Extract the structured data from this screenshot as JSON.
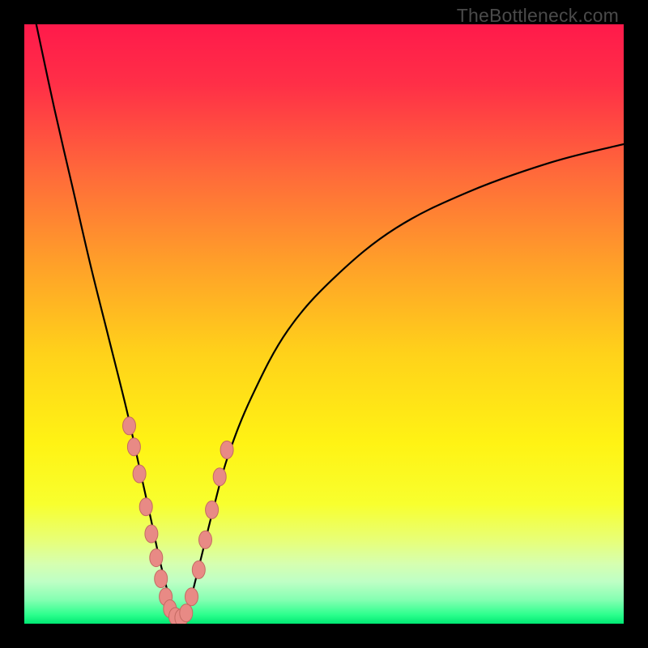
{
  "watermark": "TheBottleneck.com",
  "chart_data": {
    "type": "line",
    "title": "",
    "xlabel": "",
    "ylabel": "",
    "xlim": [
      0,
      100
    ],
    "ylim": [
      0,
      100
    ],
    "notch_x_percent": 26,
    "background_gradient": {
      "stops": [
        {
          "position": 0.0,
          "color": "#ff1a4b"
        },
        {
          "position": 0.1,
          "color": "#ff2f47"
        },
        {
          "position": 0.25,
          "color": "#ff6a3a"
        },
        {
          "position": 0.4,
          "color": "#ffa029"
        },
        {
          "position": 0.55,
          "color": "#ffd21a"
        },
        {
          "position": 0.7,
          "color": "#fff314"
        },
        {
          "position": 0.8,
          "color": "#f8ff2e"
        },
        {
          "position": 0.86,
          "color": "#e8ff76"
        },
        {
          "position": 0.9,
          "color": "#d6ffb0"
        },
        {
          "position": 0.93,
          "color": "#beffc5"
        },
        {
          "position": 0.96,
          "color": "#85ffb2"
        },
        {
          "position": 0.985,
          "color": "#2dff8d"
        },
        {
          "position": 1.0,
          "color": "#00e873"
        }
      ]
    },
    "series": [
      {
        "name": "bottleneck-curve",
        "x": [
          2.0,
          5.0,
          8.0,
          11.0,
          14.0,
          17.0,
          19.0,
          21.0,
          22.5,
          24.0,
          25.0,
          26.0,
          27.0,
          28.0,
          29.5,
          31.5,
          34.0,
          38.0,
          44.0,
          52.0,
          62.0,
          74.0,
          88.0,
          100.0
        ],
        "y": [
          100.0,
          86.0,
          73.0,
          60.0,
          48.0,
          36.0,
          27.0,
          18.0,
          11.0,
          5.0,
          1.5,
          0.5,
          1.5,
          5.0,
          11.0,
          19.0,
          28.0,
          38.0,
          49.0,
          58.0,
          66.0,
          72.0,
          77.0,
          80.0
        ]
      }
    ],
    "markers": {
      "name": "highlight-dots",
      "color": "#e88a85",
      "stroke": "#c46a62",
      "x": [
        17.5,
        18.3,
        19.2,
        20.3,
        21.2,
        22.0,
        22.8,
        23.6,
        24.3,
        25.2,
        26.2,
        27.0,
        27.9,
        29.1,
        30.2,
        31.3,
        32.6,
        33.8
      ],
      "y": [
        33.0,
        29.5,
        25.0,
        19.5,
        15.0,
        11.0,
        7.5,
        4.5,
        2.5,
        1.2,
        1.0,
        1.8,
        4.5,
        9.0,
        14.0,
        19.0,
        24.5,
        29.0
      ]
    }
  }
}
